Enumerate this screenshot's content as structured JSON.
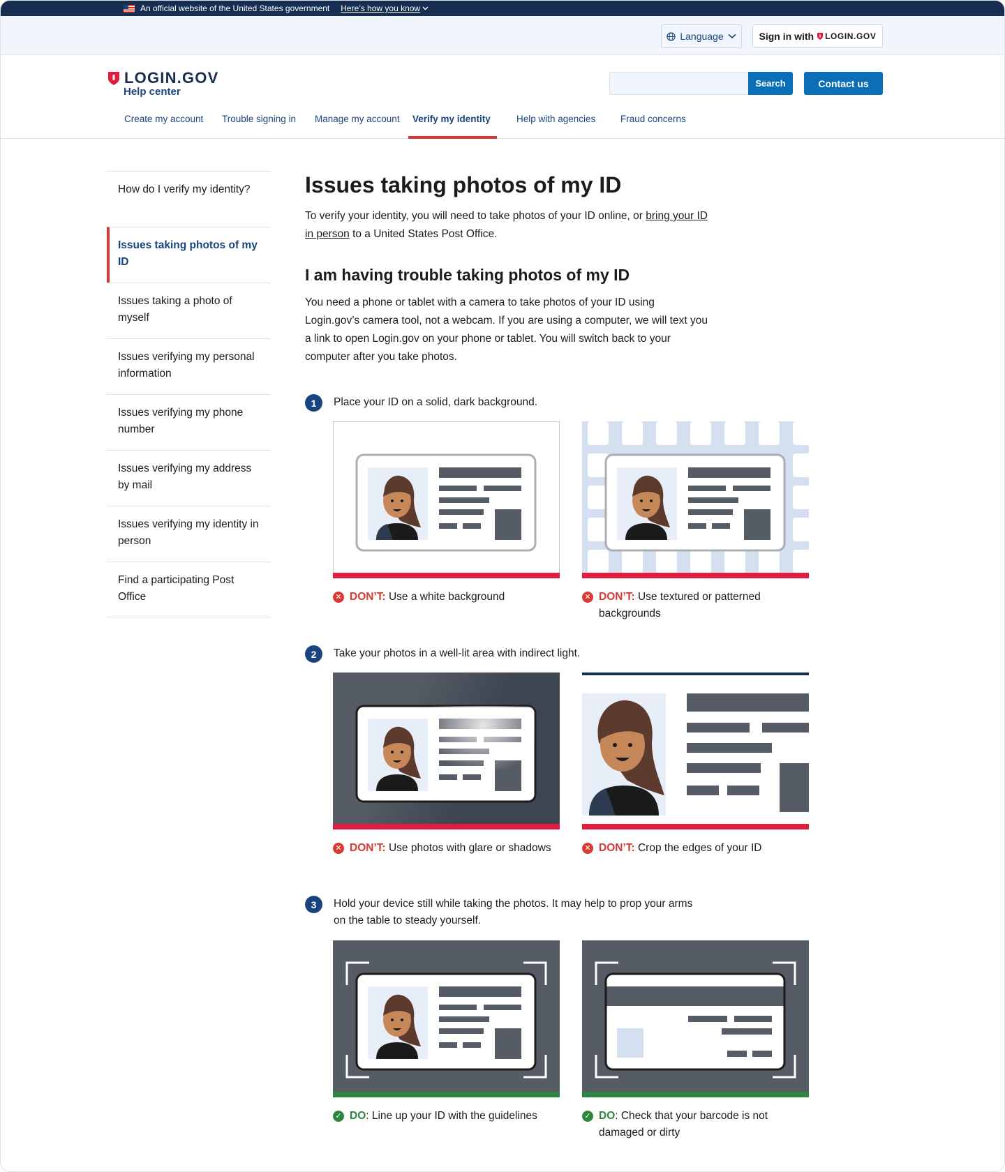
{
  "gov_banner": {
    "text": "An official website of the United States government",
    "link": "Here’s how you know"
  },
  "utility": {
    "language": "Language",
    "signin_prefix": "Sign in with",
    "signin_brand": "LOGIN.GOV"
  },
  "header": {
    "logo": "LOGIN.GOV",
    "subtitle": "Help center",
    "search_button": "Search",
    "contact_button": "Contact us"
  },
  "nav": {
    "items": [
      {
        "label": "Create my account"
      },
      {
        "label": "Trouble signing in"
      },
      {
        "label": "Manage my account"
      },
      {
        "label": "Verify my identity",
        "active": true
      },
      {
        "label": "Help with agencies"
      },
      {
        "label": "Fraud concerns"
      }
    ]
  },
  "sidebar": {
    "items": [
      {
        "label": "How do I verify my identity?"
      },
      {
        "label": "Issues taking photos of my ID",
        "active": true
      },
      {
        "label": "Issues taking a photo of myself"
      },
      {
        "label": "Issues verifying my personal information"
      },
      {
        "label": "Issues verifying my phone number"
      },
      {
        "label": "Issues verifying my address by mail"
      },
      {
        "label": "Issues verifying my identity in person"
      },
      {
        "label": "Find a participating Post Office"
      }
    ]
  },
  "main": {
    "title": "Issues taking photos of my ID",
    "lead_before": "To verify your identity, you will need to take photos of your ID online, or ",
    "lead_link": "bring your ID in person",
    "lead_after": " to a United States Post Office.",
    "subheading": "I am having trouble taking photos of my ID",
    "body": "You need a phone or tablet with a camera to take photos of your ID using Login.gov’s camera tool, not a webcam.  If you are using a computer, we will text you a link to open Login.gov on your phone or tablet. You will switch back to your computer after you take photos.",
    "steps": [
      {
        "number": "1",
        "text": "Place your ID on a solid, dark background."
      },
      {
        "number": "2",
        "text": "Take your photos in a well-lit area with indirect light."
      },
      {
        "number": "3",
        "text": "Hold your device still while taking the photos. It may help to prop your arms on the table to steady yourself."
      }
    ],
    "captions": [
      {
        "keyword": "DON’T:",
        "text": " Use a white background"
      },
      {
        "keyword": "DON’T:",
        "text": " Use textured or patterned backgrounds"
      },
      {
        "keyword": "DON’T:",
        "text": " Use photos with glare or shadows"
      },
      {
        "keyword": "DON’T:",
        "text": " Crop the edges of your ID"
      },
      {
        "keyword": "DO",
        "text": ": Line up your ID with the guidelines"
      },
      {
        "keyword": "DO",
        "text": ": Check that your barcode is not damaged or dirty"
      }
    ]
  },
  "icons": {
    "globe": "globe-icon",
    "chevron": "chevron-down-icon",
    "shield": "shield-icon",
    "dont": "x-circle-icon",
    "do": "check-circle-icon"
  },
  "colors": {
    "primary": "#1a4480",
    "button": "#0b6fb8",
    "dont": "#d83933",
    "do": "#2e8540",
    "banner": "#162e51"
  }
}
